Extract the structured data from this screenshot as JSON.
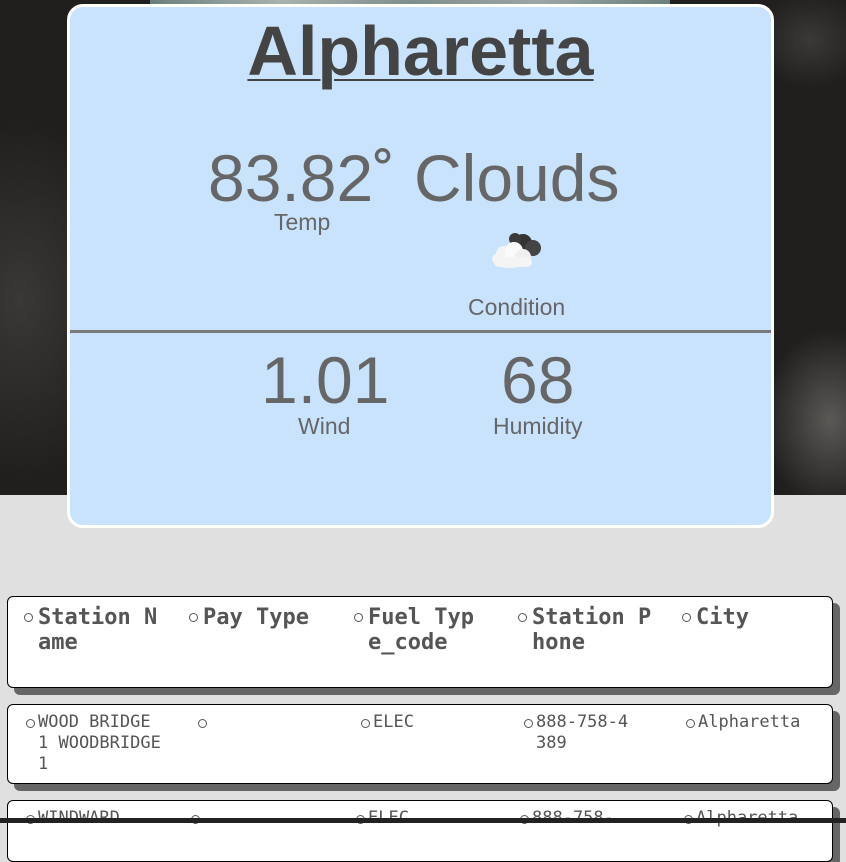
{
  "weather": {
    "city": "Alpharetta",
    "temp": "83.82˚",
    "temp_label": "Temp",
    "condition": "Clouds",
    "condition_label": "Condition",
    "condition_icon": "cloud-icon",
    "wind": "1.01",
    "wind_label": "Wind",
    "humidity": "68",
    "humidity_label": "Humidity"
  },
  "stations": {
    "columns": [
      "Station Name",
      "Pay Type",
      "Fuel Type_code",
      "Station Phone",
      "City"
    ],
    "rows": [
      [
        "WOOD BRIDGE 1 WOODBRIDGE1",
        "",
        "ELEC",
        "888-758-4389",
        "Alpharetta"
      ],
      [
        "WINDWARD",
        "",
        "ELEC",
        "888-758-",
        "Alpharetta"
      ]
    ]
  }
}
